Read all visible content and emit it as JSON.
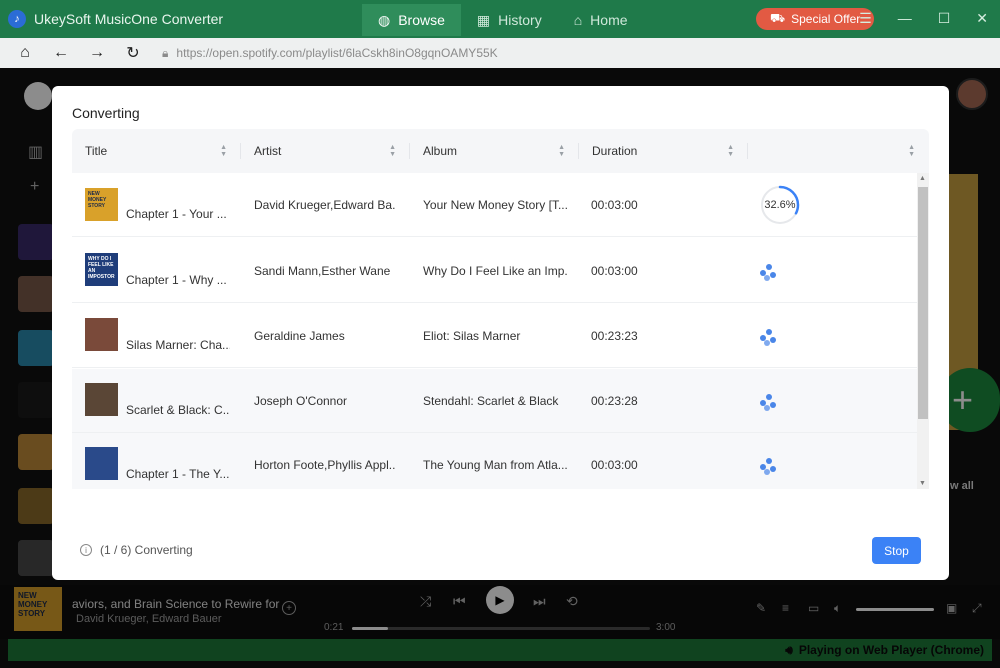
{
  "app": {
    "title": "UkeySoft MusicOne Converter"
  },
  "nav_tabs": [
    {
      "label": "Browse",
      "icon": "globe-icon"
    },
    {
      "label": "History",
      "icon": "history-icon"
    },
    {
      "label": "Home",
      "icon": "home-icon"
    }
  ],
  "special_offer": "Special Offer",
  "browser": {
    "url": "https://open.spotify.com/playlist/6laCskh8inO8gqnOAMY55K"
  },
  "dialog": {
    "title": "Converting",
    "columns": [
      "Title",
      "Artist",
      "Album",
      "Duration"
    ],
    "rows": [
      {
        "title": "Chapter 1 - Your ...",
        "artist": "David Krueger,Edward Ba...",
        "album": "Your New Money Story [T...",
        "duration": "00:03:00",
        "status": "progress",
        "progress": "32.6%",
        "progress_value": 32.6,
        "cover_text": "NEW MONEY STORY",
        "cover_color": "#d9a12a"
      },
      {
        "title": "Chapter 1 - Why ...",
        "artist": "Sandi Mann,Esther Wane",
        "album": "Why Do I Feel Like an Imp...",
        "duration": "00:03:00",
        "status": "waiting",
        "cover_text": "WHY DO I FEEL LIKE AN IMPOSTOR",
        "cover_color": "#1f3d7a"
      },
      {
        "title": "Silas Marner: Cha...",
        "artist": "Geraldine James",
        "album": "Eliot: Silas Marner",
        "duration": "00:23:23",
        "status": "waiting",
        "cover_text": "",
        "cover_color": "#7a4a3a"
      },
      {
        "title": "Scarlet & Black: C...",
        "artist": "Joseph O'Connor",
        "album": "Stendahl: Scarlet & Black",
        "duration": "00:23:28",
        "status": "waiting",
        "cover_text": "",
        "cover_color": "#5a4636"
      },
      {
        "title": "Chapter 1 - The Y...",
        "artist": "Horton Foote,Phyllis Appl...",
        "album": "The Young Man from Atla...",
        "duration": "00:03:00",
        "status": "waiting",
        "cover_text": "",
        "cover_color": "#2a4a8a"
      }
    ],
    "status_text": "(1 / 6) Converting",
    "stop_label": "Stop"
  },
  "player": {
    "track": "aviors, and Brain Science to Rewire for",
    "artist": "David Krueger, Edward Bauer",
    "cover_text": "NEW MONEY STORY",
    "time_elapsed": "0:21",
    "time_total": "3:00",
    "progress": 0.12
  },
  "status_bar": "Playing on Web Player (Chrome)",
  "side_labels": {
    "see_all": "w all"
  },
  "colors": {
    "accent": "#3b82f6",
    "titlebar": "#1f7a4a",
    "spotify_green": "#1e7a3a"
  }
}
